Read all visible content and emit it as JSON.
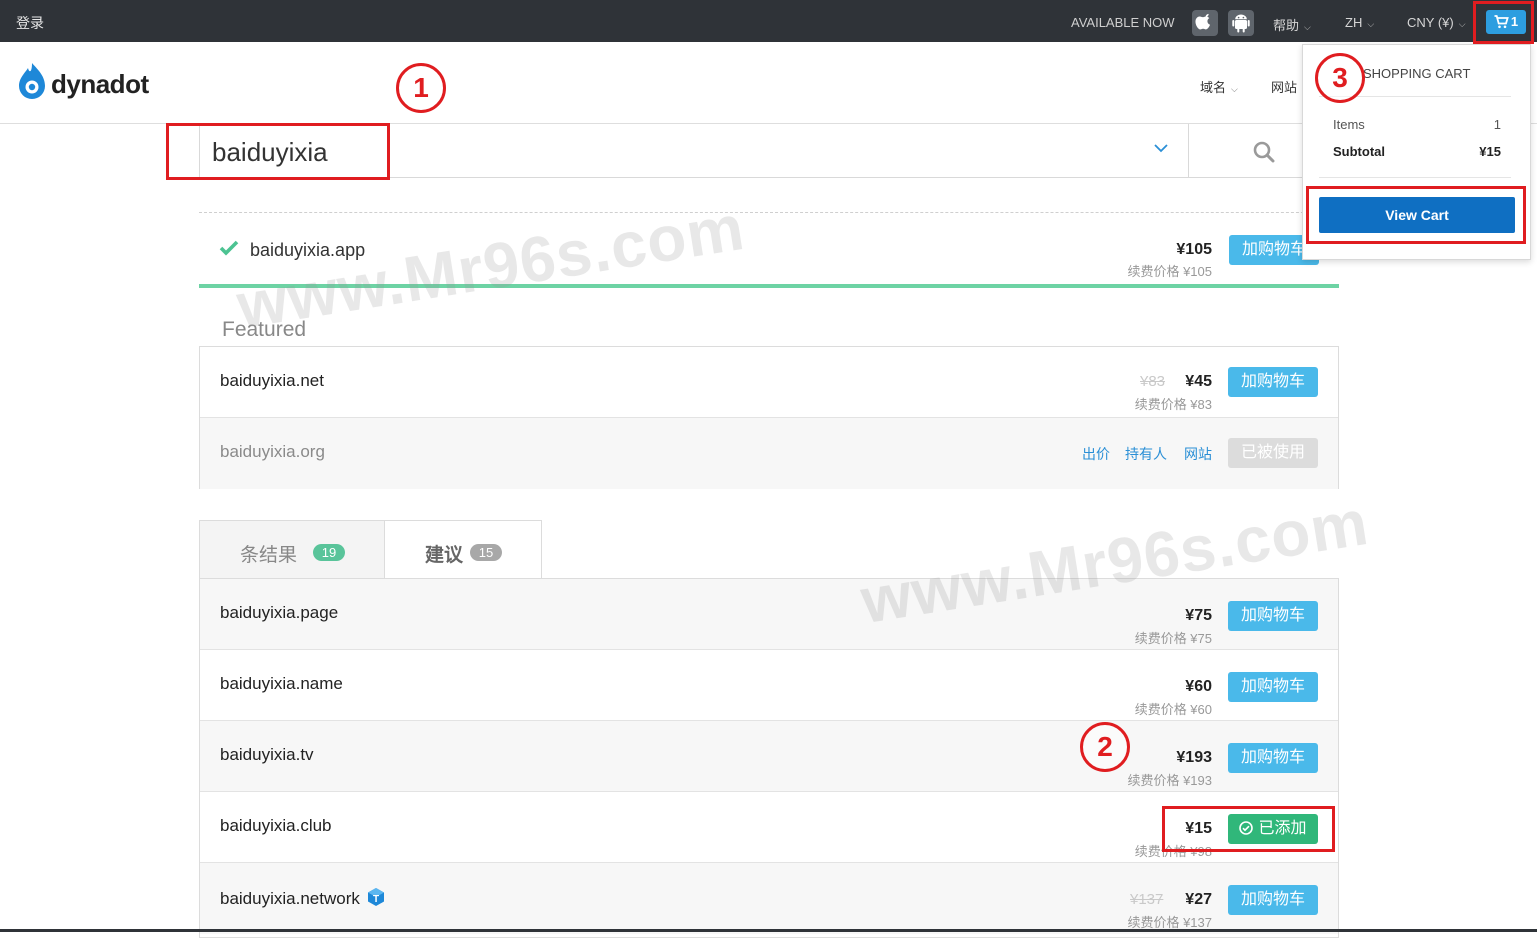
{
  "topbar": {
    "login": "登录",
    "available_now": "AVAILABLE NOW",
    "help": "帮助",
    "language": "ZH",
    "currency": "CNY (¥)",
    "cart_count": "1"
  },
  "icons": [
    "apple-icon",
    "android-icon",
    "cart-icon",
    "search-icon",
    "check-icon",
    "premium-badge-icon"
  ],
  "header": {
    "logo_text": "dynadot",
    "nav_domains": "域名",
    "nav_website": "网站"
  },
  "search": {
    "query": "baiduyixia"
  },
  "top_result": {
    "domain": "baiduyixia.app",
    "price": "¥105",
    "renewal": "续费价格 ¥105",
    "action": "加购物车"
  },
  "featured": {
    "title": "Featured",
    "rows": [
      {
        "domain": "baiduyixia.net",
        "old_price": "¥83",
        "price": "¥45",
        "renewal": "续费价格 ¥83",
        "action": "加购物车"
      },
      {
        "domain": "baiduyixia.org",
        "links": [
          "出价",
          "持有人",
          "网站"
        ],
        "action": "已被使用"
      }
    ]
  },
  "tabs": [
    {
      "label": "条结果",
      "count": "19"
    },
    {
      "label": "建议",
      "count": "15"
    }
  ],
  "results": [
    {
      "domain": "baiduyixia.page",
      "price": "¥75",
      "renewal": "续费价格 ¥75",
      "action": "加购物车"
    },
    {
      "domain": "baiduyixia.name",
      "price": "¥60",
      "renewal": "续费价格 ¥60",
      "action": "加购物车"
    },
    {
      "domain": "baiduyixia.tv",
      "price": "¥193",
      "renewal": "续费价格 ¥193",
      "action": "加购物车"
    },
    {
      "domain": "baiduyixia.club",
      "price": "¥15",
      "renewal": "续费价格 ¥98",
      "action": "已添加"
    },
    {
      "domain": "baiduyixia.network",
      "old_price": "¥137",
      "price": "¥27",
      "renewal": "续费价格 ¥137",
      "action": "加购物车"
    }
  ],
  "cart": {
    "title": "SHOPPING CART",
    "items_label": "Items",
    "items_value": "1",
    "subtotal_label": "Subtotal",
    "subtotal_value": "¥15",
    "button": "View Cart"
  },
  "annotations": [
    "1",
    "2",
    "3"
  ],
  "watermarks": [
    "www.Mr96s.com",
    "www.Mr96s.com"
  ],
  "colors": {
    "topbar": "#2f3338",
    "accent_blue": "#4ab9ea",
    "added_green": "#30b77a",
    "view_cart_blue": "#0f6fc2",
    "annotation_red": "#e01d20"
  }
}
